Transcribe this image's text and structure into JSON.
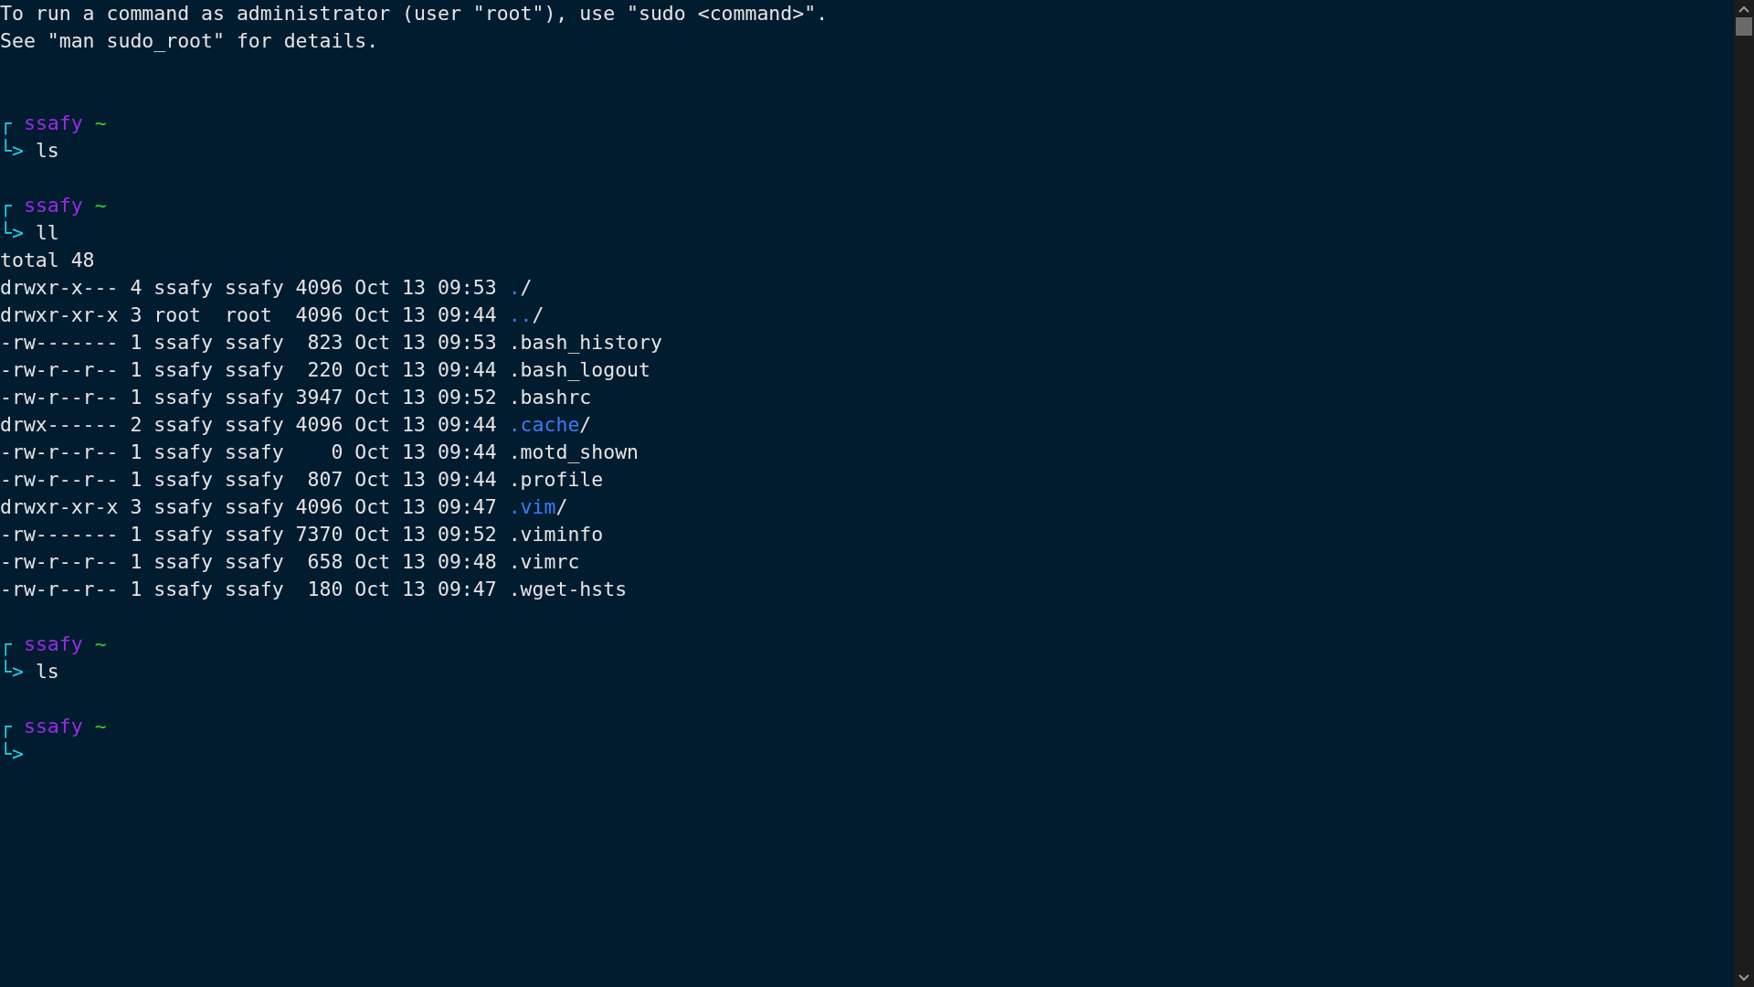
{
  "terminal": {
    "lines": [
      {
        "kind": "text",
        "text": "To run a command as administrator (user \"root\"), use \"sudo <command>\"."
      },
      {
        "kind": "text",
        "text": "See \"man sudo_root\" for details."
      },
      {
        "kind": "gap"
      },
      {
        "kind": "gap"
      },
      {
        "kind": "prompt",
        "corner": "┌",
        "user": "ssafy",
        "dir": "~"
      },
      {
        "kind": "command",
        "arrow": "└>",
        "text": "ls"
      },
      {
        "kind": "gap"
      },
      {
        "kind": "prompt",
        "corner": "┌",
        "user": "ssafy",
        "dir": "~"
      },
      {
        "kind": "command",
        "arrow": "└>",
        "text": "ll"
      },
      {
        "kind": "text",
        "text": "total 48"
      },
      {
        "kind": "dir",
        "meta": "drwxr-x--- 4 ssafy ssafy 4096 Oct 13 09:53",
        "name": ".",
        "suffix": "/"
      },
      {
        "kind": "dir",
        "meta": "drwxr-xr-x 3 root  root  4096 Oct 13 09:44",
        "name": "..",
        "suffix": "/"
      },
      {
        "kind": "file",
        "meta": "-rw------- 1 ssafy ssafy  823 Oct 13 09:53",
        "name": ".bash_history"
      },
      {
        "kind": "file",
        "meta": "-rw-r--r-- 1 ssafy ssafy  220 Oct 13 09:44",
        "name": ".bash_logout"
      },
      {
        "kind": "file",
        "meta": "-rw-r--r-- 1 ssafy ssafy 3947 Oct 13 09:52",
        "name": ".bashrc"
      },
      {
        "kind": "dir",
        "meta": "drwx------ 2 ssafy ssafy 4096 Oct 13 09:44",
        "name": ".cache",
        "suffix": "/"
      },
      {
        "kind": "file",
        "meta": "-rw-r--r-- 1 ssafy ssafy    0 Oct 13 09:44",
        "name": ".motd_shown"
      },
      {
        "kind": "file",
        "meta": "-rw-r--r-- 1 ssafy ssafy  807 Oct 13 09:44",
        "name": ".profile"
      },
      {
        "kind": "dir",
        "meta": "drwxr-xr-x 3 ssafy ssafy 4096 Oct 13 09:47",
        "name": ".vim",
        "suffix": "/"
      },
      {
        "kind": "file",
        "meta": "-rw------- 1 ssafy ssafy 7370 Oct 13 09:52",
        "name": ".viminfo"
      },
      {
        "kind": "file",
        "meta": "-rw-r--r-- 1 ssafy ssafy  658 Oct 13 09:48",
        "name": ".vimrc"
      },
      {
        "kind": "file",
        "meta": "-rw-r--r-- 1 ssafy ssafy  180 Oct 13 09:47",
        "name": ".wget-hsts"
      },
      {
        "kind": "gap"
      },
      {
        "kind": "prompt",
        "corner": "┌",
        "user": "ssafy",
        "dir": "~"
      },
      {
        "kind": "command",
        "arrow": "└>",
        "text": "ls"
      },
      {
        "kind": "gap"
      },
      {
        "kind": "prompt",
        "corner": "┌",
        "user": "ssafy",
        "dir": "~"
      },
      {
        "kind": "command",
        "arrow": "└>"
      }
    ]
  }
}
